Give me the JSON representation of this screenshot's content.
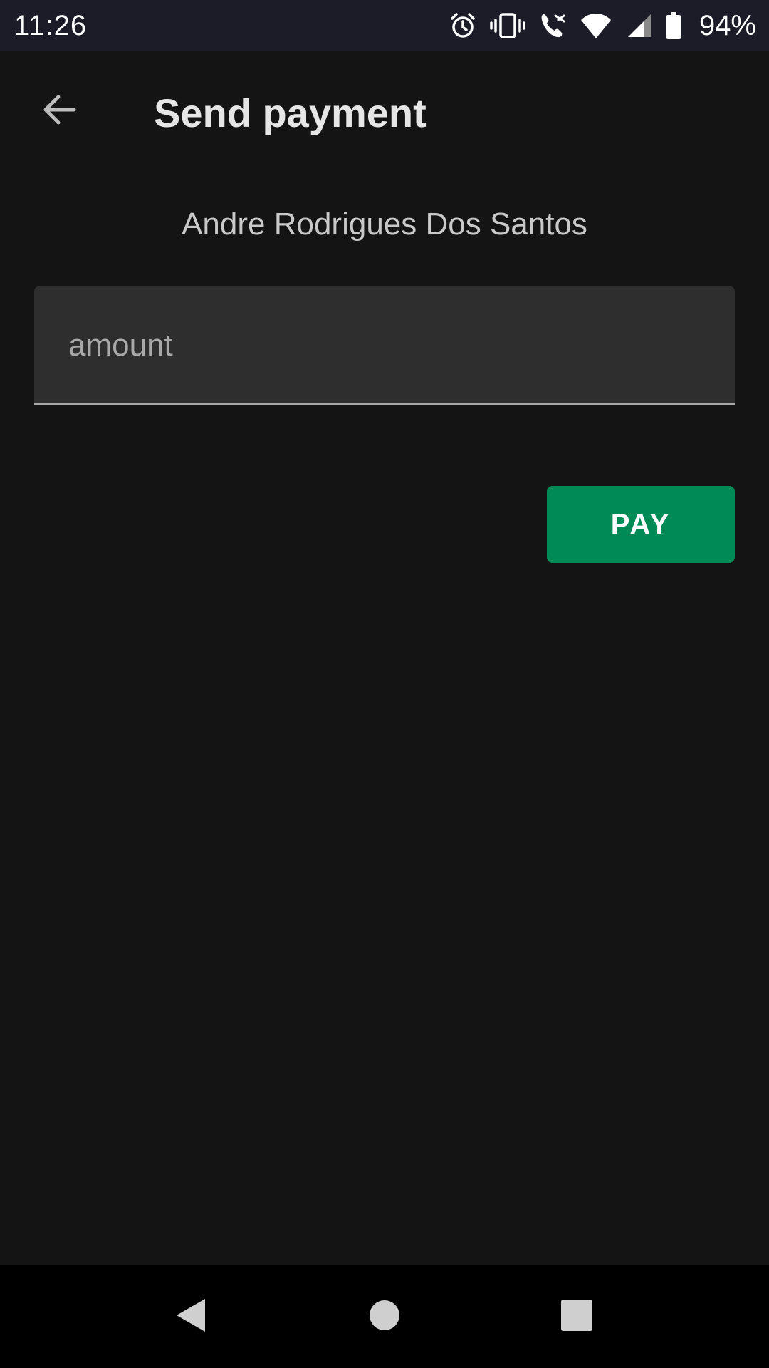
{
  "status_bar": {
    "time": "11:26",
    "battery_percent": "94%",
    "icons": [
      "alarm-icon",
      "vibrate-icon",
      "wifi-calling-icon",
      "wifi-icon",
      "cell-signal-icon",
      "battery-icon"
    ]
  },
  "app_bar": {
    "title": "Send payment",
    "back_icon": "arrow-left-icon"
  },
  "recipient": {
    "name": "Andre Rodrigues Dos Santos"
  },
  "amount_field": {
    "placeholder": "amount",
    "value": ""
  },
  "pay_button": {
    "label": "PAY"
  },
  "nav_bar": {
    "icons": [
      "nav-back-icon",
      "nav-home-icon",
      "nav-recents-icon"
    ]
  },
  "colors": {
    "background": "#141414",
    "status_bar": "#1c1c28",
    "field_background": "#2e2e2e",
    "accent_green": "#008a55",
    "nav_bar": "#000000"
  }
}
